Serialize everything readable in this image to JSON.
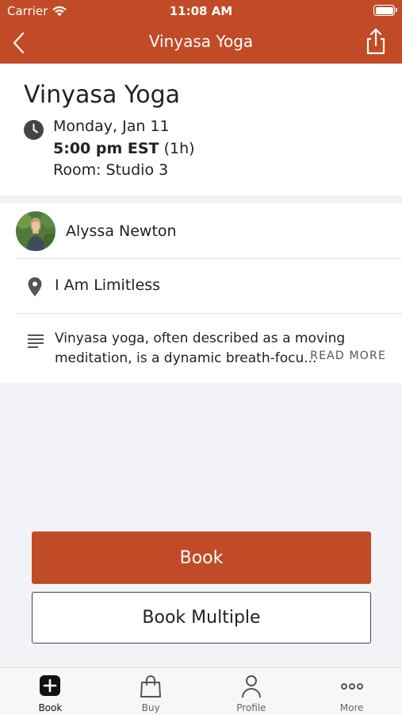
{
  "status_bar": {
    "carrier": "Carrier",
    "time": "11:08 AM"
  },
  "nav": {
    "title": "Vinyasa Yoga",
    "back_icon": "chevron-left-icon",
    "share_icon": "share-icon"
  },
  "class": {
    "title": "Vinyasa Yoga",
    "date": "Monday, Jan 11",
    "time": "5:00 pm EST",
    "duration": "(1h)",
    "room": "Room: Studio 3"
  },
  "instructor": {
    "name": "Alyssa Newton"
  },
  "location": {
    "name": "I Am Limitless"
  },
  "description": {
    "text": "Vinyasa yoga, often described as a moving meditation, is a dynamic breath-focu...",
    "read_more": "READ MORE"
  },
  "actions": {
    "book": "Book",
    "book_multiple": "Book Multiple"
  },
  "tabs": [
    {
      "label": "Book",
      "icon": "plus-square-icon",
      "active": true
    },
    {
      "label": "Buy",
      "icon": "shopping-bag-icon",
      "active": false
    },
    {
      "label": "Profile",
      "icon": "person-icon",
      "active": false
    },
    {
      "label": "More",
      "icon": "more-dots-icon",
      "active": false
    }
  ],
  "colors": {
    "accent": "#c14b26",
    "background": "#f2f3f6"
  }
}
